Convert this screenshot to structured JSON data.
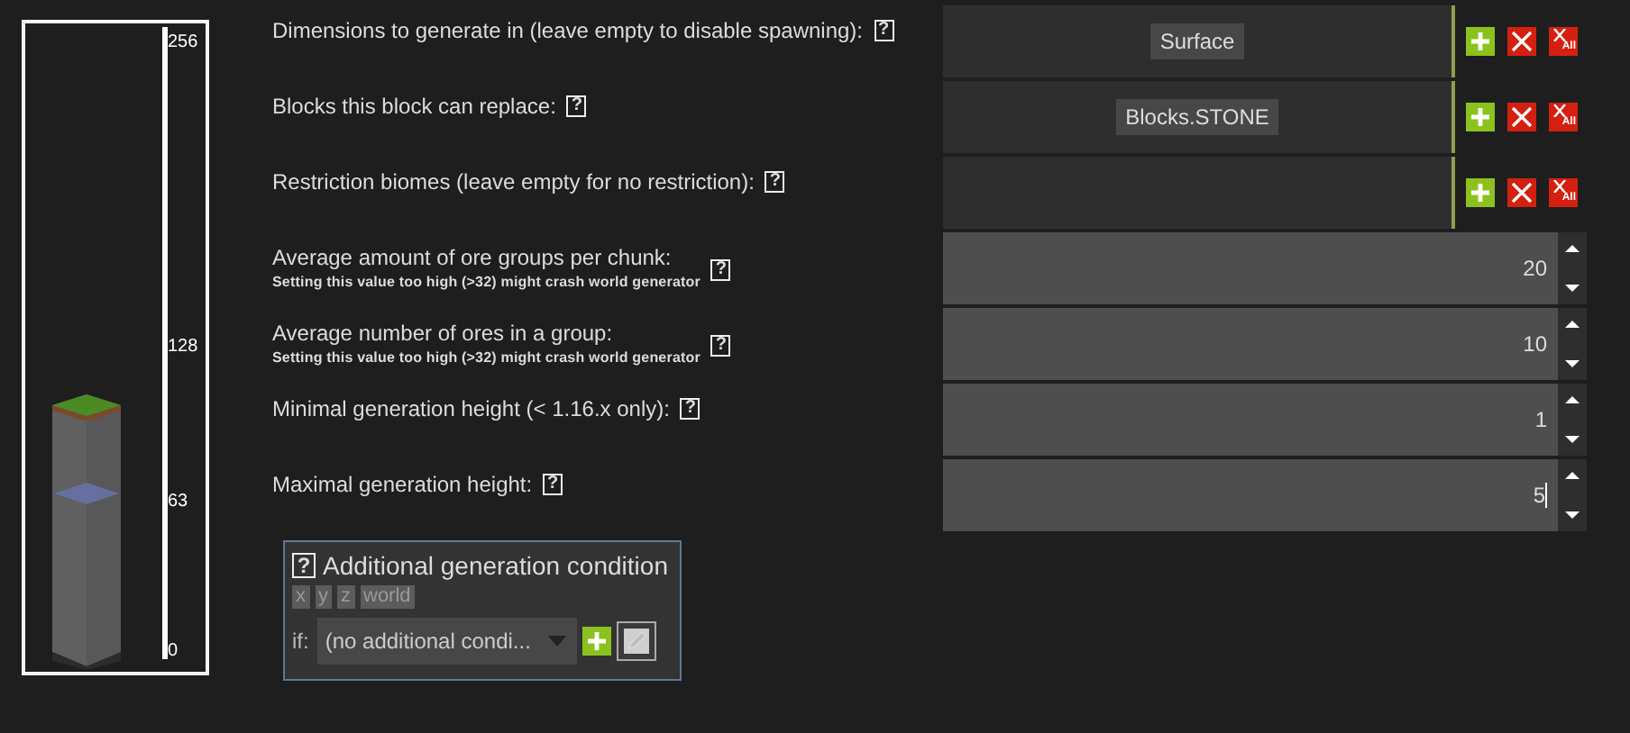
{
  "height_scale": [
    "256",
    "128",
    "63",
    "0"
  ],
  "list_rows": [
    {
      "label": "Dimensions to generate in (leave empty to disable spawning):",
      "help": "?",
      "items": [
        "Surface"
      ],
      "clear_all_label": "All"
    },
    {
      "label": "Blocks this block can replace:",
      "help": "?",
      "items": [
        "Blocks.STONE"
      ],
      "clear_all_label": "All"
    },
    {
      "label": "Restriction biomes (leave empty for no restriction):",
      "help": "?",
      "items": [],
      "clear_all_label": "All"
    }
  ],
  "number_rows": [
    {
      "label": "Average amount of ore groups per chunk:",
      "note": "Setting this value too high (>32) might crash world generator",
      "help": "?",
      "value": "20",
      "focused": false
    },
    {
      "label": "Average number of ores in a group:",
      "note": "Setting this value too high (>32) might crash world generator",
      "help": "?",
      "value": "10",
      "focused": false
    },
    {
      "label": "Minimal generation height (< 1.16.x only):",
      "help": "?",
      "value": "1",
      "focused": false
    },
    {
      "label": "Maximal generation height:",
      "help": "?",
      "value": "5",
      "focused": true
    }
  ],
  "condition": {
    "help": "?",
    "title": "Additional generation condition",
    "variables": [
      "x",
      "y",
      "z",
      "world"
    ],
    "if_label": "if:",
    "dropdown": "(no additional condi..."
  }
}
